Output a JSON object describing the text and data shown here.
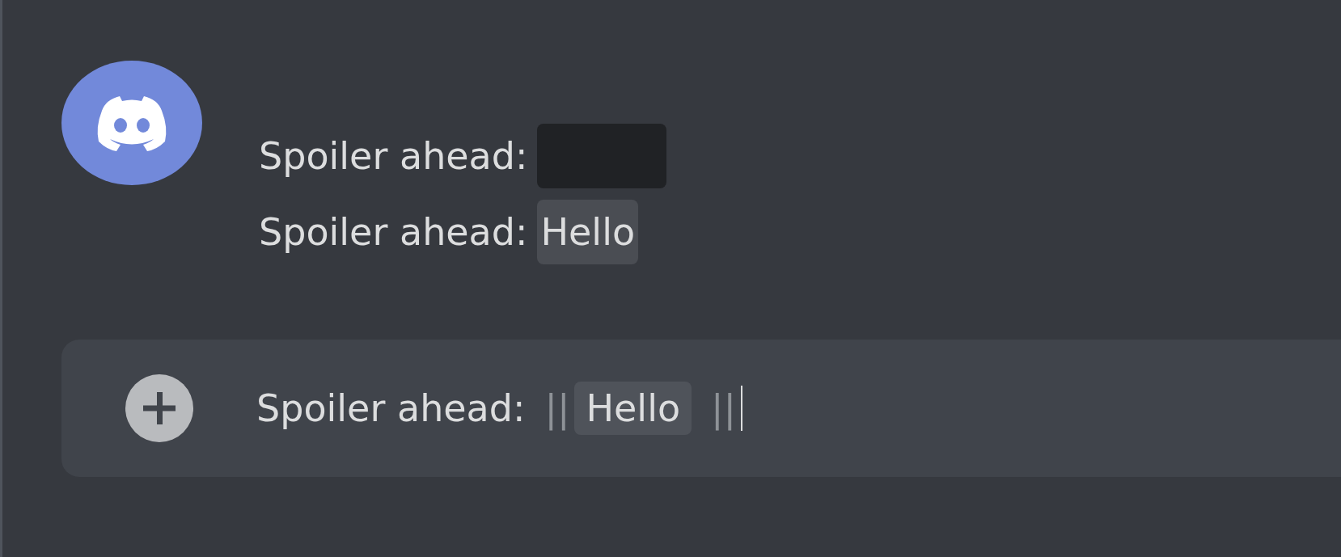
{
  "messages": [
    {
      "text": "Spoiler ahead:",
      "spoiler": {
        "revealed": false
      }
    },
    {
      "text": "Spoiler ahead:",
      "spoiler": {
        "revealed": true,
        "text": "Hello"
      }
    }
  ],
  "composer": {
    "text": "Spoiler ahead:",
    "open_marker": "||",
    "spoiler_text": "Hello",
    "close_marker": "||",
    "focused": true
  }
}
